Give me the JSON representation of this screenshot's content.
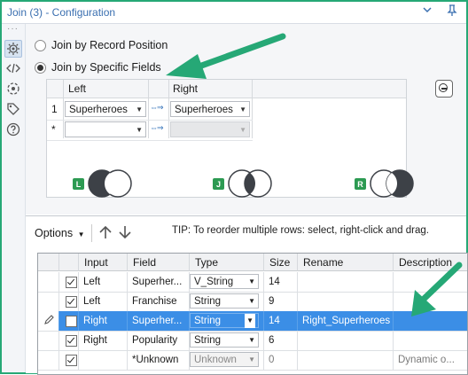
{
  "window": {
    "title": "Join (3) - Configuration"
  },
  "join_modes": {
    "record_position": "Join by Record Position",
    "specific_fields": "Join by Specific Fields"
  },
  "join_grid": {
    "headers": {
      "left": "Left",
      "right": "Right"
    },
    "rows": [
      {
        "num": "1",
        "left": "Superheroes",
        "right": "Superheroes"
      },
      {
        "num": "*",
        "left": "",
        "right": ""
      }
    ]
  },
  "venn": {
    "left": "L",
    "join": "J",
    "right": "R"
  },
  "toolbar": {
    "options_label": "Options",
    "tip": "TIP: To reorder multiple rows: select, right-click and drag."
  },
  "fields_table": {
    "headers": [
      "Input",
      "Field",
      "Type",
      "Size",
      "Rename",
      "Description"
    ],
    "rows": [
      {
        "checked": true,
        "input": "Left",
        "field": "Superher...",
        "type": "V_String",
        "size": "14",
        "rename": "",
        "description": ""
      },
      {
        "checked": true,
        "input": "Left",
        "field": "Franchise",
        "type": "String",
        "size": "9",
        "rename": "",
        "description": ""
      },
      {
        "checked": false,
        "input": "Right",
        "field": "Superher...",
        "type": "String",
        "size": "14",
        "rename": "Right_Superheroes",
        "description": ""
      },
      {
        "checked": true,
        "input": "Right",
        "field": "Popularity",
        "type": "String",
        "size": "6",
        "rename": "",
        "description": ""
      },
      {
        "checked": true,
        "input": "",
        "field": "*Unknown",
        "type": "Unknown",
        "size": "0",
        "rename": "",
        "description": "Dynamic o..."
      }
    ]
  },
  "colors": {
    "accent": "#26a876",
    "selection": "#3b8ee6",
    "title": "#3a6fb0"
  }
}
